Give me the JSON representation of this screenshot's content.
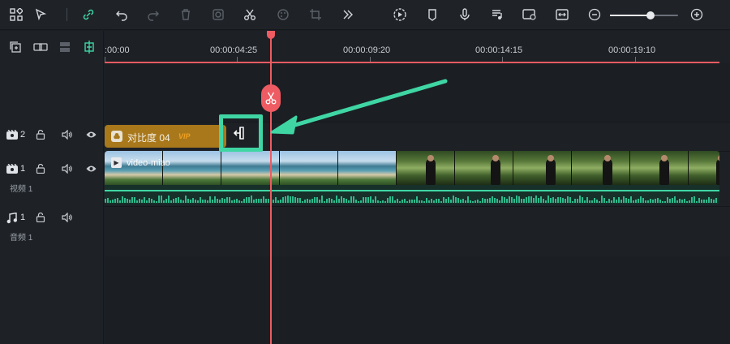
{
  "toolbar": {
    "left_icons": [
      "layout-icon",
      "select-pointer-icon",
      "link-icon",
      "undo-icon",
      "redo-icon",
      "delete-icon",
      "crop-effect-icon",
      "cut-icon",
      "color-icon",
      "transform-icon",
      "more-icon"
    ],
    "right_icons": [
      "render-preview-icon",
      "marker-icon",
      "microphone-icon",
      "audio-mix-icon",
      "auto-reframe-icon",
      "fit-icon",
      "zoom-out-icon",
      "zoom-in-icon"
    ],
    "zoom_level": 0.6
  },
  "left_tools": [
    "add-track-icon",
    "link-track-icon",
    "track-layout-icon",
    "snap-icon"
  ],
  "tracks": [
    {
      "icon": "video-track-icon",
      "number": "2",
      "name": ""
    },
    {
      "icon": "video-track-icon",
      "number": "1",
      "name": "视频 1"
    },
    {
      "icon": "music-track-icon",
      "number": "1",
      "name": "音频 1"
    }
  ],
  "ruler": {
    "labels": [
      ":00:00",
      "00:00:04:25",
      "00:00:09:20",
      "00:00:14:15",
      "00:00:19:10"
    ]
  },
  "clips": {
    "effect": {
      "label": "对比度 04",
      "badge": "VIP"
    },
    "video": {
      "label": "video-miao"
    }
  },
  "colors": {
    "accent": "#3fd6a4",
    "playhead": "#ee5b62",
    "effect_clip": "#a8781b"
  }
}
